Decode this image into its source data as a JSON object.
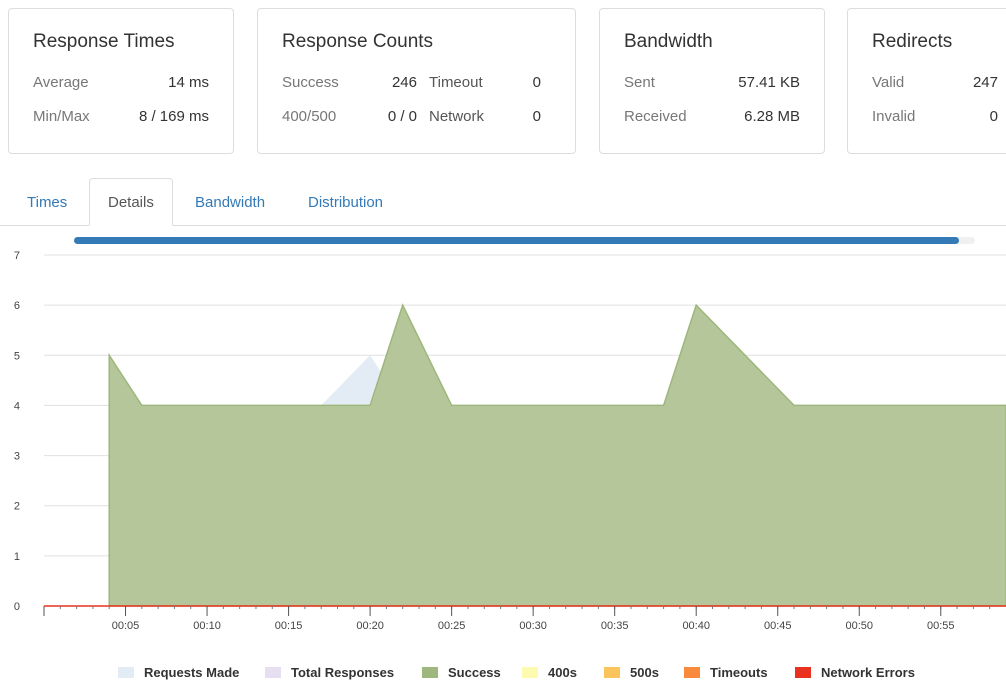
{
  "cards": {
    "response_times": {
      "title": "Response Times",
      "rows": [
        {
          "label": "Average",
          "value": "14 ms"
        },
        {
          "label": "Min/Max",
          "value": "8 / 169 ms"
        }
      ]
    },
    "response_counts": {
      "title": "Response Counts",
      "rows": [
        {
          "label": "Success",
          "value": "246",
          "label2": "Timeout",
          "value2": "0"
        },
        {
          "label": "400/500",
          "value": "0 / 0",
          "label2": "Network",
          "value2": "0"
        }
      ]
    },
    "bandwidth": {
      "title": "Bandwidth",
      "rows": [
        {
          "label": "Sent",
          "value": "57.41 KB"
        },
        {
          "label": "Received",
          "value": "6.28 MB"
        }
      ]
    },
    "redirects": {
      "title": "Redirects",
      "rows": [
        {
          "label": "Valid",
          "value": "247"
        },
        {
          "label": "Invalid",
          "value": "0"
        }
      ]
    }
  },
  "tabs": [
    {
      "label": "Times",
      "active": false
    },
    {
      "label": "Details",
      "active": true
    },
    {
      "label": "Bandwidth",
      "active": false
    },
    {
      "label": "Distribution",
      "active": false
    }
  ],
  "progress": {
    "fraction": 0.982,
    "color": "#337ab7"
  },
  "legend": [
    {
      "label": "Requests Made",
      "color": "#e3ecf4"
    },
    {
      "label": "Total Responses",
      "color": "#e6dff2"
    },
    {
      "label": "Success",
      "color": "#9db77c"
    },
    {
      "label": "400s",
      "color": "#fdfbaf"
    },
    {
      "label": "500s",
      "color": "#fcc45c"
    },
    {
      "label": "Timeouts",
      "color": "#f98a3c"
    },
    {
      "label": "Network Errors",
      "color": "#e8321f"
    }
  ],
  "chart_data": {
    "type": "area",
    "ylim": [
      0,
      7
    ],
    "yticks": [
      "0",
      "1",
      "2",
      "3",
      "4",
      "5",
      "6",
      "7"
    ],
    "xlim": [
      0,
      59
    ],
    "xticks": [
      {
        "t": 5,
        "label": "00:05"
      },
      {
        "t": 10,
        "label": "00:10"
      },
      {
        "t": 15,
        "label": "00:15"
      },
      {
        "t": 20,
        "label": "00:20"
      },
      {
        "t": 25,
        "label": "00:25"
      },
      {
        "t": 30,
        "label": "00:30"
      },
      {
        "t": 35,
        "label": "00:35"
      },
      {
        "t": 40,
        "label": "00:40"
      },
      {
        "t": 45,
        "label": "00:45"
      },
      {
        "t": 50,
        "label": "00:50"
      },
      {
        "t": 55,
        "label": "00:55"
      }
    ],
    "grid": true,
    "series": [
      {
        "name": "Requests Made",
        "color": "#e3ecf4",
        "points": [
          [
            4,
            0
          ],
          [
            4,
            5
          ],
          [
            6,
            4
          ],
          [
            17,
            4
          ],
          [
            20,
            5
          ],
          [
            22,
            4
          ],
          [
            59,
            4
          ],
          [
            59,
            0
          ]
        ]
      },
      {
        "name": "Success",
        "color": "#b5c79a",
        "stroke": "#9db77c",
        "points": [
          [
            4,
            0
          ],
          [
            4,
            5
          ],
          [
            6,
            4
          ],
          [
            20,
            4
          ],
          [
            22,
            6
          ],
          [
            25,
            4
          ],
          [
            38,
            4
          ],
          [
            40,
            6
          ],
          [
            46,
            4
          ],
          [
            59,
            4
          ],
          [
            59,
            0
          ]
        ]
      },
      {
        "name": "Network Errors",
        "color": "#e8321f",
        "points": [
          [
            0,
            0
          ],
          [
            59,
            0
          ]
        ]
      }
    ]
  }
}
